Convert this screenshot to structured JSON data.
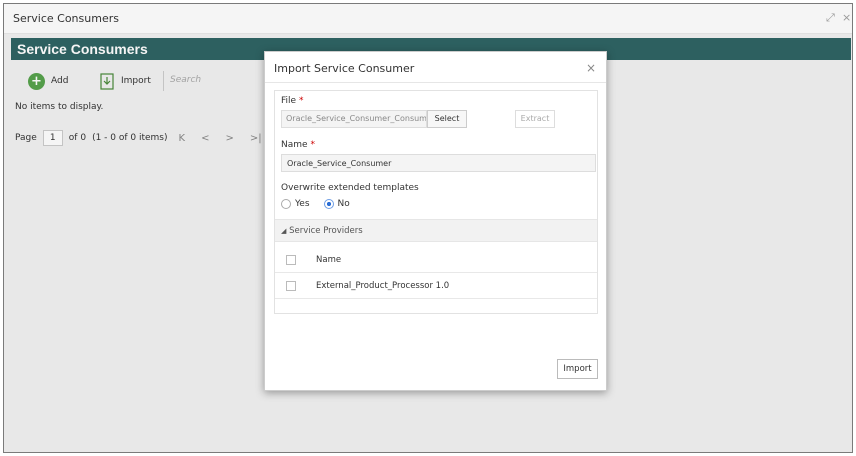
{
  "window": {
    "title": "Service Consumers",
    "controls": [
      "⤢",
      "×"
    ]
  },
  "page": {
    "header_title": "Service Consumers",
    "toolbar": {
      "add_label": "Add",
      "import_label": "Import",
      "search_placeholder": "Search"
    },
    "empty_message": "No items to display.",
    "pager": {
      "page_label": "Page",
      "page_number": "1",
      "of_text": "of 0",
      "items_text": "(1 - 0 of 0 items)",
      "first": "K",
      "prev": "<",
      "next": ">",
      "last": ">|"
    }
  },
  "modal": {
    "title": "Import Service Consumer",
    "close": "×",
    "file": {
      "label": "File",
      "required_mark": "*",
      "value": "Oracle_Service_Consumer_Consume",
      "select_label": "Select",
      "extract_label": "Extract"
    },
    "name": {
      "label": "Name",
      "required_mark": "*",
      "value": "Oracle_Service_Consumer"
    },
    "overwrite": {
      "label": "Overwrite extended templates",
      "options": [
        "Yes",
        "No"
      ],
      "selected": "No"
    },
    "service_providers": {
      "header": "Service Providers",
      "column_name": "Name",
      "rows": [
        "External_Product_Processor 1.0"
      ]
    },
    "import_label": "Import"
  },
  "colors": {
    "band": "#2f6464",
    "add_green": "#57a34c",
    "radio_blue": "#2b6fd6",
    "required": "#cc0000"
  }
}
